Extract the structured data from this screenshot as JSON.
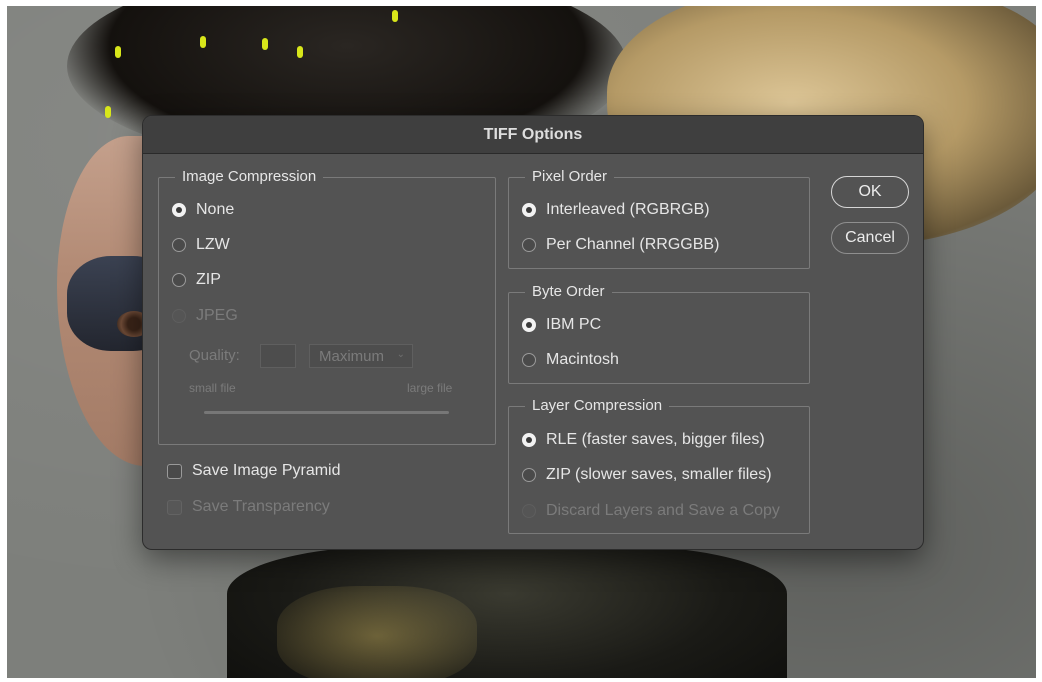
{
  "dialog": {
    "title": "TIFF Options",
    "ok_label": "OK",
    "cancel_label": "Cancel"
  },
  "image_compression": {
    "legend": "Image Compression",
    "options": [
      {
        "label": "None",
        "checked": true,
        "disabled": false
      },
      {
        "label": "LZW",
        "checked": false,
        "disabled": false
      },
      {
        "label": "ZIP",
        "checked": false,
        "disabled": false
      },
      {
        "label": "JPEG",
        "checked": false,
        "disabled": true
      }
    ],
    "quality_label": "Quality:",
    "quality_value": "",
    "quality_preset": "Maximum",
    "small_file_label": "small file",
    "large_file_label": "large file"
  },
  "checkboxes": {
    "save_image_pyramid": "Save Image Pyramid",
    "save_transparency": "Save Transparency"
  },
  "pixel_order": {
    "legend": "Pixel Order",
    "options": [
      {
        "label": "Interleaved (RGBRGB)",
        "checked": true
      },
      {
        "label": "Per Channel (RRGGBB)",
        "checked": false
      }
    ]
  },
  "byte_order": {
    "legend": "Byte Order",
    "options": [
      {
        "label": "IBM PC",
        "checked": true
      },
      {
        "label": "Macintosh",
        "checked": false
      }
    ]
  },
  "layer_compression": {
    "legend": "Layer Compression",
    "options": [
      {
        "label": "RLE (faster saves, bigger files)",
        "checked": true,
        "disabled": false
      },
      {
        "label": "ZIP (slower saves, smaller files)",
        "checked": false,
        "disabled": false
      },
      {
        "label": "Discard Layers and Save a Copy",
        "checked": false,
        "disabled": true
      }
    ]
  },
  "colors": {
    "dialog_bg": "#535353",
    "titlebar_bg": "#3f3f3f",
    "text": "#e6e6e6",
    "disabled_text": "#7b7b7b"
  }
}
